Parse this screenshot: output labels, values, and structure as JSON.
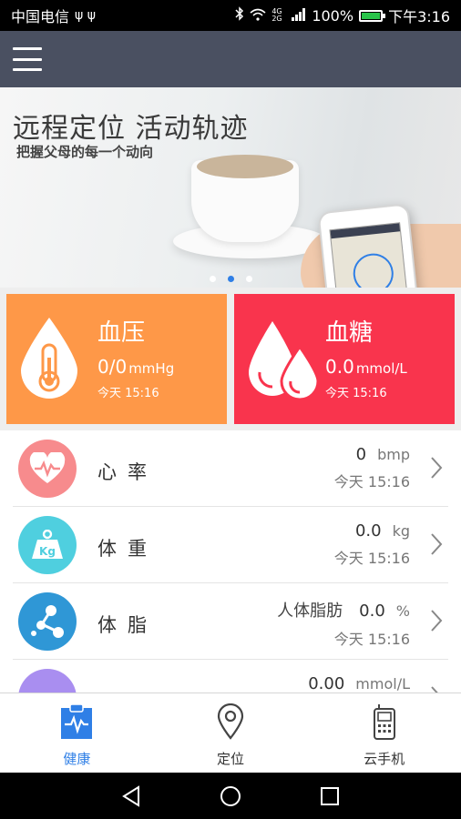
{
  "status_bar": {
    "carrier": "中国电信",
    "usb_icons": "ψ ψ",
    "signal_badge": "4G 2G",
    "battery": "100%",
    "battery_level": 1.0,
    "time": "下午3:16"
  },
  "banner": {
    "title": "远程定位 活动轨迹",
    "subtitle": "把握父母的每一个动向",
    "page_count": 3,
    "active_page": 2
  },
  "cards": {
    "blood_pressure": {
      "title": "血压",
      "value": "0/0",
      "unit": "mmHg",
      "time": "今天 15:16",
      "color": "#fe9848"
    },
    "blood_sugar": {
      "title": "血糖",
      "value": "0.0",
      "unit": "mmol/L",
      "time": "今天 15:16",
      "color": "#f9344d"
    }
  },
  "list": {
    "items": [
      {
        "label": "心率",
        "prefix": "",
        "value": "0",
        "unit": "bmp",
        "time": "今天 15:16",
        "icon": "heart-rate-icon",
        "color": "#f78b8d"
      },
      {
        "label": "体重",
        "prefix": "",
        "value": "0.0",
        "unit": "kg",
        "time": "今天 15:16",
        "icon": "weight-icon",
        "color": "#4fcfdf"
      },
      {
        "label": "体脂",
        "prefix": "人体脂肪",
        "value": "0.0",
        "unit": "%",
        "time": "今天 15:16",
        "icon": "molecule-icon",
        "color": "#2f97d6"
      },
      {
        "label": "",
        "prefix": "",
        "value": "0.00",
        "unit": "mmol/L",
        "time": "",
        "icon": "partial-icon",
        "color": "#a98ef0"
      }
    ]
  },
  "bottom_nav": {
    "health": "健康",
    "location": "定位",
    "cloud_phone": "云手机",
    "active_color": "#2f7fe6"
  }
}
